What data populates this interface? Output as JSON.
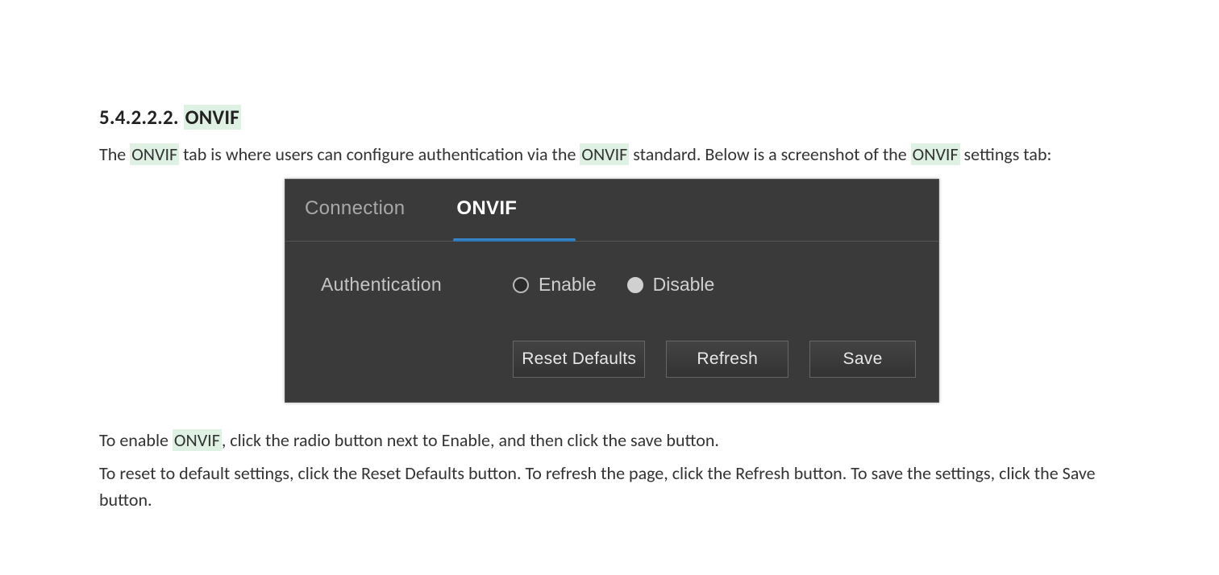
{
  "heading": {
    "number": "5.4.2.2.2.",
    "title": "ONVIF"
  },
  "intro": {
    "p1a": "The ",
    "hl1": "ONVIF",
    "p1b": " tab is where users can configure authentication via the ",
    "hl2": "ONVIF",
    "p1c": " standard. Below is a screenshot of the ",
    "hl3": "ONVIF",
    "p1d": " settings tab:"
  },
  "tabs": {
    "connection": "Connection",
    "onvif": "ONVIF"
  },
  "panel": {
    "auth_label": "Authentication",
    "enable": "Enable",
    "disable": "Disable",
    "selected": "disable"
  },
  "buttons": {
    "reset": "Reset Defaults",
    "refresh": "Refresh",
    "save": "Save"
  },
  "closing": {
    "p2a": "To enable ",
    "hl4": "ONVIF",
    "p2b": ", click the radio button next to Enable, and then click the save button.",
    "p3": "To reset to default settings, click the Reset Defaults button. To refresh the page, click the Refresh button. To save the settings, click the Save button."
  }
}
